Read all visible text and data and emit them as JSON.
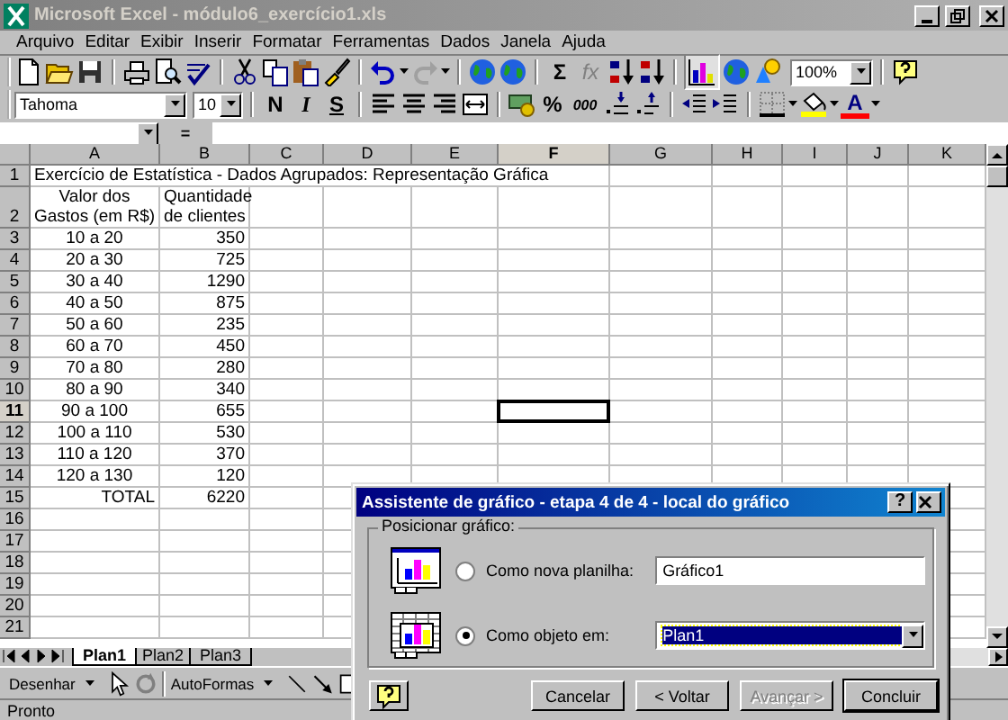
{
  "window": {
    "title": "Microsoft Excel - módulo6_exercício1.xls"
  },
  "menu": [
    "Arquivo",
    "Editar",
    "Exibir",
    "Inserir",
    "Formatar",
    "Ferramentas",
    "Dados",
    "Janela",
    "Ajuda"
  ],
  "standard_toolbar": {
    "undo": {
      "disabled": false
    },
    "redo": {
      "disabled": true
    },
    "sum": "Σ",
    "function": {
      "label": "fx",
      "disabled": true
    },
    "chart_wizard": {
      "pressed": true
    },
    "zoom": "100%"
  },
  "formatting_toolbar": {
    "font": "Tahoma",
    "size": "10",
    "bold": "N",
    "italic": "I",
    "underline": "S",
    "percent": "%",
    "thousands": "000",
    "font_color": "A"
  },
  "formula_bar": {
    "equals": "="
  },
  "sheet": {
    "columns": [
      {
        "label": "A",
        "selected": false
      },
      {
        "label": "B",
        "selected": false
      },
      {
        "label": "C",
        "selected": false
      },
      {
        "label": "D",
        "selected": false
      },
      {
        "label": "E",
        "selected": false
      },
      {
        "label": "F",
        "selected": true
      },
      {
        "label": "G",
        "selected": false
      },
      {
        "label": "H",
        "selected": false
      },
      {
        "label": "I",
        "selected": false
      },
      {
        "label": "J",
        "selected": false
      },
      {
        "label": "K",
        "selected": false
      }
    ],
    "rows": [
      {
        "label": "1",
        "selected": false,
        "cells": [
          {
            "kind": "title",
            "text": "Exercício de Estatística - Dados Agrupados: Representação Gráfica"
          }
        ]
      },
      {
        "label": "2",
        "selected": false,
        "cells": [
          {
            "kind": "header",
            "text": "Valor dos\nGastos (em R$)"
          },
          {
            "kind": "header",
            "text": "Quantidade\nde clientes"
          }
        ]
      },
      {
        "label": "3",
        "selected": false,
        "cells": [
          {
            "kind": "range",
            "text": "10 a 20"
          },
          {
            "kind": "number",
            "text": "350"
          }
        ]
      },
      {
        "label": "4",
        "selected": false,
        "cells": [
          {
            "kind": "range",
            "text": "20 a 30"
          },
          {
            "kind": "number",
            "text": "725"
          }
        ]
      },
      {
        "label": "5",
        "selected": false,
        "cells": [
          {
            "kind": "range",
            "text": "30 a 40"
          },
          {
            "kind": "number",
            "text": "1290"
          }
        ]
      },
      {
        "label": "6",
        "selected": false,
        "cells": [
          {
            "kind": "range",
            "text": "40 a 50"
          },
          {
            "kind": "number",
            "text": "875"
          }
        ]
      },
      {
        "label": "7",
        "selected": false,
        "cells": [
          {
            "kind": "range",
            "text": "50 a 60"
          },
          {
            "kind": "number",
            "text": "235"
          }
        ]
      },
      {
        "label": "8",
        "selected": false,
        "cells": [
          {
            "kind": "range",
            "text": "60 a 70"
          },
          {
            "kind": "number",
            "text": "450"
          }
        ]
      },
      {
        "label": "9",
        "selected": false,
        "cells": [
          {
            "kind": "range",
            "text": "70 a 80"
          },
          {
            "kind": "number",
            "text": "280"
          }
        ]
      },
      {
        "label": "10",
        "selected": false,
        "cells": [
          {
            "kind": "range",
            "text": "80 a 90"
          },
          {
            "kind": "number",
            "text": "340"
          }
        ]
      },
      {
        "label": "11",
        "selected": true,
        "cells": [
          {
            "kind": "range",
            "text": "90 a 100"
          },
          {
            "kind": "number",
            "text": "655"
          }
        ]
      },
      {
        "label": "12",
        "selected": false,
        "cells": [
          {
            "kind": "range",
            "text": "100 a 110"
          },
          {
            "kind": "number",
            "text": "530"
          }
        ]
      },
      {
        "label": "13",
        "selected": false,
        "cells": [
          {
            "kind": "range",
            "text": "110 a 120"
          },
          {
            "kind": "number",
            "text": "370"
          }
        ]
      },
      {
        "label": "14",
        "selected": false,
        "cells": [
          {
            "kind": "range",
            "text": "120 a 130"
          },
          {
            "kind": "number",
            "text": "120"
          }
        ]
      },
      {
        "label": "15",
        "selected": false,
        "cells": [
          {
            "kind": "total",
            "text": "TOTAL"
          },
          {
            "kind": "number",
            "text": "6220"
          }
        ]
      },
      {
        "label": "16",
        "selected": false,
        "cells": []
      },
      {
        "label": "17",
        "selected": false,
        "cells": []
      },
      {
        "label": "18",
        "selected": false,
        "cells": []
      },
      {
        "label": "19",
        "selected": false,
        "cells": []
      },
      {
        "label": "20",
        "selected": false,
        "cells": []
      },
      {
        "label": "21",
        "selected": false,
        "cells": []
      }
    ]
  },
  "sheet_tabs": [
    {
      "label": "Plan1",
      "selected": true
    },
    {
      "label": "Plan2",
      "selected": false
    },
    {
      "label": "Plan3",
      "selected": false
    }
  ],
  "drawing_toolbar": {
    "draw_menu": "Desenhar",
    "autoshapes": "AutoFormas"
  },
  "status_bar": {
    "text": "Pronto"
  },
  "dialog": {
    "title": "Assistente de gráfico - etapa 4 de 4 - local do gráfico",
    "help_glyph": "?",
    "group_label": "Posicionar gráfico:",
    "options": [
      {
        "kind": "sheet",
        "label": "Como nova planilha:",
        "selected": false,
        "value": "Gráfico1"
      },
      {
        "kind": "object",
        "label": "Como objeto em:",
        "selected": true,
        "value": "Plan1"
      }
    ],
    "buttons": [
      {
        "label": "Cancelar",
        "disabled": false,
        "default": false
      },
      {
        "label": "< Voltar",
        "disabled": false,
        "default": false
      },
      {
        "label": "Avançar >",
        "disabled": true,
        "default": false
      },
      {
        "label": "Concluir",
        "disabled": false,
        "default": true
      }
    ]
  }
}
